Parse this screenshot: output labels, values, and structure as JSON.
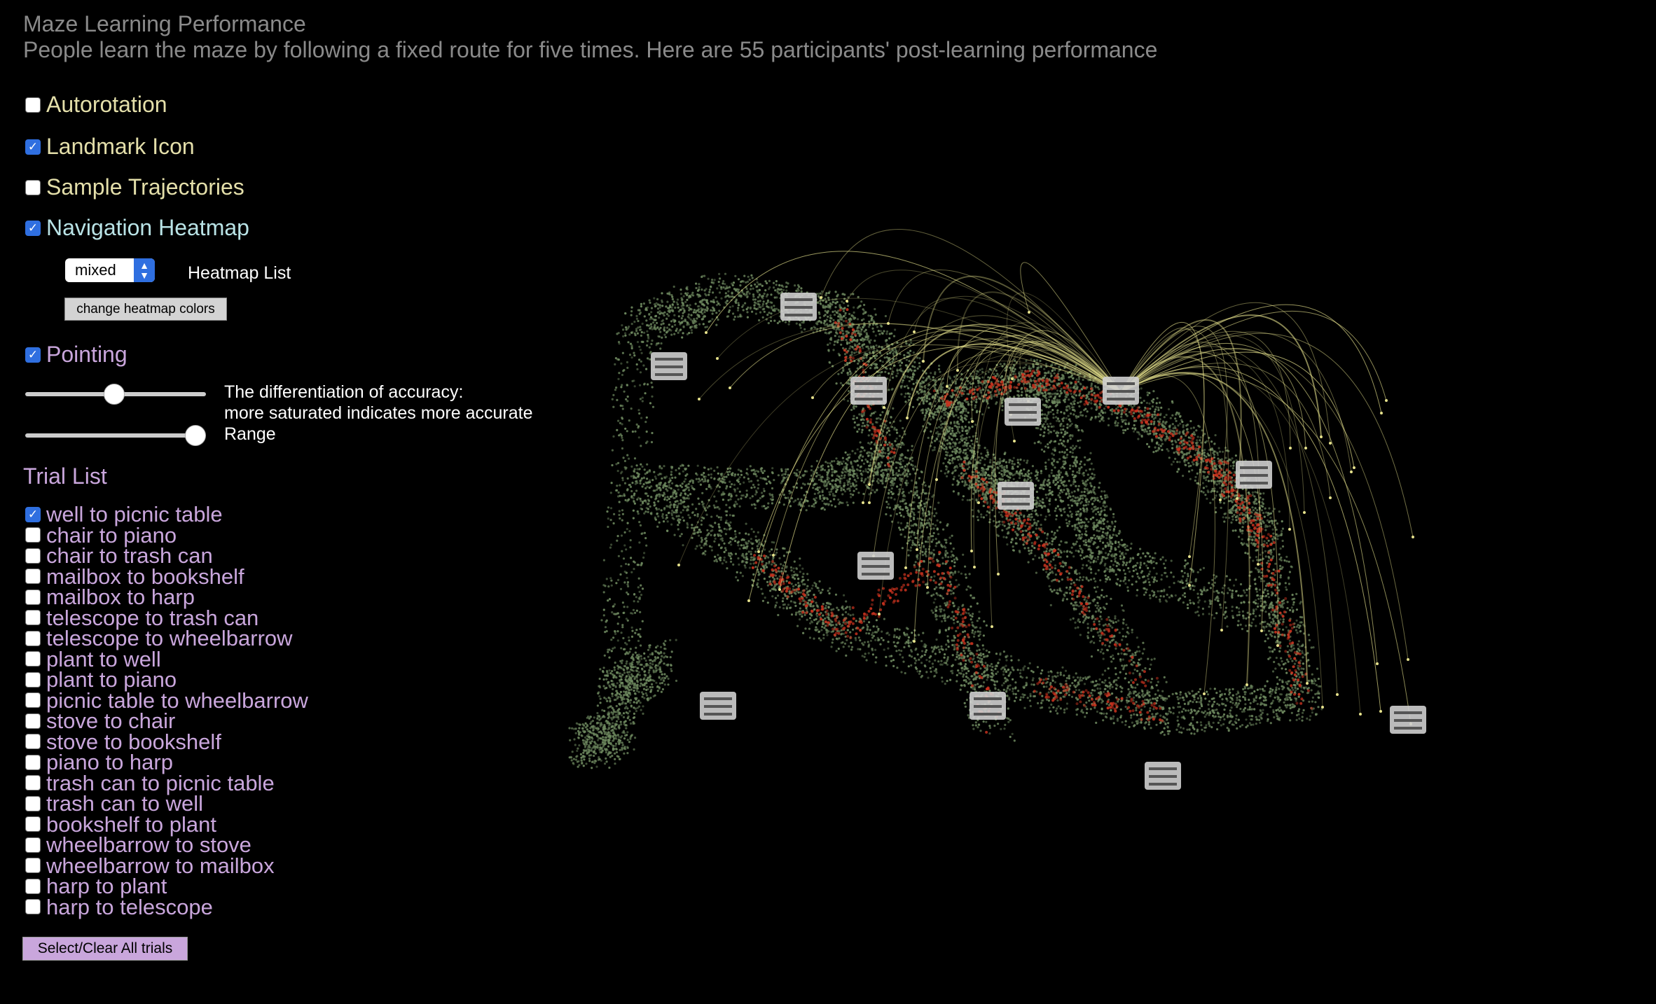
{
  "header": {
    "title": "Maze Learning Performance",
    "subtitle": "People learn the maze by following a fixed route for five times. Here are 55 participants' post-learning performance"
  },
  "options": {
    "autorotation": {
      "label": "Autorotation",
      "checked": false
    },
    "landmark_icon": {
      "label": "Landmark Icon",
      "checked": true
    },
    "sample_trajectories": {
      "label": "Sample Trajectories",
      "checked": false
    },
    "navigation_heatmap": {
      "label": "Navigation Heatmap",
      "checked": true
    },
    "pointing": {
      "label": "Pointing",
      "checked": true
    }
  },
  "heatmap": {
    "selected": "mixed",
    "list_label": "Heatmap List",
    "change_colors_label": "change heatmap colors"
  },
  "pointing_controls": {
    "accuracy_text_1": "The differentiation of accuracy:",
    "accuracy_text_2": "more saturated indicates more accurate",
    "range_text": "Range",
    "accuracy_value": 0.5,
    "range_value": 1.0
  },
  "trials": {
    "title": "Trial List",
    "items": [
      {
        "label": "well to picnic table",
        "checked": true
      },
      {
        "label": "chair to piano",
        "checked": false
      },
      {
        "label": "chair to trash can",
        "checked": false
      },
      {
        "label": "mailbox to bookshelf",
        "checked": false
      },
      {
        "label": "mailbox to harp",
        "checked": false
      },
      {
        "label": "telescope to trash can",
        "checked": false
      },
      {
        "label": "telescope to wheelbarrow",
        "checked": false
      },
      {
        "label": "plant to well",
        "checked": false
      },
      {
        "label": "plant to piano",
        "checked": false
      },
      {
        "label": "picnic table to wheelbarrow",
        "checked": false
      },
      {
        "label": "stove to chair",
        "checked": false
      },
      {
        "label": "stove to bookshelf",
        "checked": false
      },
      {
        "label": "piano to harp",
        "checked": false
      },
      {
        "label": "trash can to picnic table",
        "checked": false
      },
      {
        "label": "trash can to well",
        "checked": false
      },
      {
        "label": "bookshelf to plant",
        "checked": false
      },
      {
        "label": "wheelbarrow to stove",
        "checked": false
      },
      {
        "label": "wheelbarrow to mailbox",
        "checked": false
      },
      {
        "label": "harp to plant",
        "checked": false
      },
      {
        "label": "harp to telescope",
        "checked": false
      }
    ],
    "select_all_label": "Select/Clear All trials"
  },
  "colors": {
    "heat_green": "#6f8a60",
    "heat_red": "#c8321e",
    "arc_yellow": "#e6e28c",
    "icon_gray": "#cfcfcf"
  },
  "landmarks": [
    "piano",
    "trash-can",
    "bookshelf",
    "harp",
    "well",
    "chair",
    "wheelbarrow",
    "picnic-table",
    "stove",
    "plant",
    "telescope",
    "mailbox"
  ]
}
